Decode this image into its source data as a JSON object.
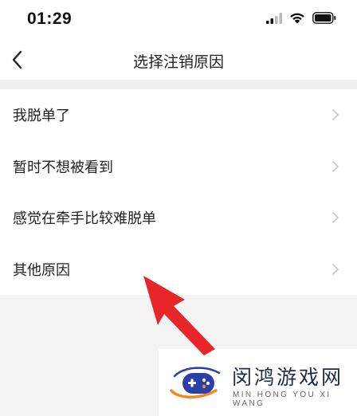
{
  "status_bar": {
    "time": "01:29",
    "icons": [
      "signal-icon",
      "wifi-icon",
      "battery-icon"
    ]
  },
  "nav": {
    "back_icon": "chevron-left-icon",
    "title": "选择注销原因"
  },
  "reasons": [
    {
      "label": "我脱单了"
    },
    {
      "label": "暂时不想被看到"
    },
    {
      "label": "感觉在牵手比较难脱单"
    },
    {
      "label": "其他原因"
    }
  ],
  "annotation": {
    "arrow_color": "#e8262a",
    "icon": "arrow-annotation"
  },
  "watermark": {
    "title": "闵鸿游戏网",
    "subtitle": "MIN HONG YOU XI WANG",
    "icon": "gamepad-logo-icon"
  },
  "colors": {
    "background": "#f3f3f3",
    "surface": "#ffffff",
    "text": "#222222",
    "chevron": "#c8c8c8",
    "accent_red": "#e8262a",
    "logo_blue": "#2b3fa8",
    "logo_orange": "#f08a24"
  }
}
